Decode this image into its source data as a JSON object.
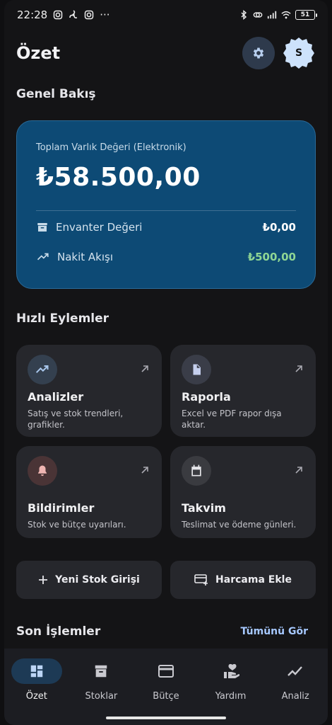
{
  "status_bar": {
    "time": "22:28",
    "more": "···",
    "battery": "51"
  },
  "header": {
    "title": "Özet",
    "avatar_initial": "S"
  },
  "overview": {
    "section_title": "Genel Bakış",
    "label": "Toplam Varlık Değeri (Elektronik)",
    "value": "₺58.500,00",
    "rows": [
      {
        "label": "Envanter Değeri",
        "amount": "₺0,00",
        "icon": "archive-icon"
      },
      {
        "label": "Nakit Akışı",
        "amount": "₺500,00",
        "icon": "trending-up-icon",
        "amount_color": "#8fd694"
      }
    ]
  },
  "quick_actions": {
    "section_title": "Hızlı Eylemler",
    "items": [
      {
        "title": "Analizler",
        "desc": "Satış ve stok trendleri, grafikler.",
        "icon": "trending-up-icon"
      },
      {
        "title": "Raporla",
        "desc": "Excel ve PDF rapor dışa aktar.",
        "icon": "document-icon"
      },
      {
        "title": "Bildirimler",
        "desc": "Stok ve bütçe uyarıları.",
        "icon": "bell-icon"
      },
      {
        "title": "Takvim",
        "desc": "Teslimat ve ödeme günleri.",
        "icon": "calendar-icon"
      }
    ],
    "buttons": [
      {
        "label": "Yeni Stok Girişi",
        "icon": "plus-icon"
      },
      {
        "label": "Harcama Ekle",
        "icon": "card-add-icon"
      }
    ]
  },
  "recent": {
    "section_title": "Son İşlemler",
    "see_all": "Tümünü Gör"
  },
  "nav": [
    {
      "label": "Özet",
      "icon": "dashboard-icon",
      "active": true
    },
    {
      "label": "Stoklar",
      "icon": "archive-icon"
    },
    {
      "label": "Bütçe",
      "icon": "credit-card-icon"
    },
    {
      "label": "Yardım",
      "icon": "helping-hand-icon"
    },
    {
      "label": "Analiz",
      "icon": "chart-line-icon"
    }
  ],
  "colors": {
    "accent": "#0d4a75",
    "positive": "#8fd694",
    "link": "#a6c8ff"
  }
}
